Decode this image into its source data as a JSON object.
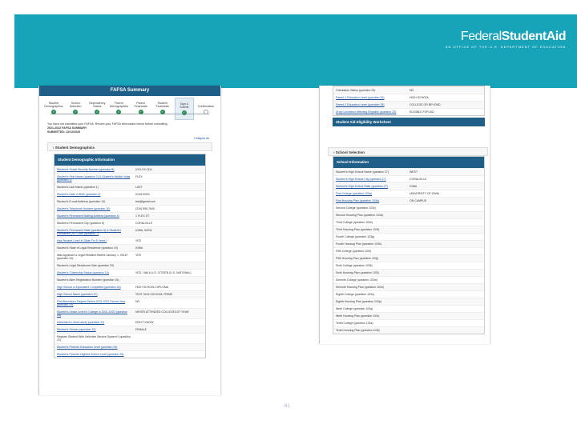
{
  "banner": {
    "brand_federal": "Federal",
    "brand_studentaid": "StudentAid",
    "tagline": "AN OFFICE OF THE U.S. DEPARTMENT OF EDUCATION"
  },
  "left_panel": {
    "title": "FAFSA Summary",
    "steps": [
      {
        "label": "Student Demographics",
        "done": true
      },
      {
        "label": "School Selection",
        "done": true
      },
      {
        "label": "Dependency Status",
        "done": true
      },
      {
        "label": "Parent Demographics",
        "done": true
      },
      {
        "label": "Parent Financials",
        "done": true
      },
      {
        "label": "Student Financials",
        "done": true
      },
      {
        "label": "Sign & Submit",
        "done": true,
        "active": true
      },
      {
        "label": "Confirmation",
        "done": false
      }
    ],
    "intro_line1": "You have not submitted your FAFSA. Review your FAFSA information below before submitting.",
    "intro_line2": "2021-2022 FAFSA SUMMARY",
    "intro_line3": "SUBMITTED: 12/12/2020",
    "collapse_all": "Collapse All",
    "section_title": "Student Demographics",
    "table_title": "Student Demographic Information",
    "rows": [
      {
        "q": "Student's Social Security Number (question 8)",
        "a": "XXX-XX-1111",
        "link": true
      },
      {
        "q": "Student's First Name (question 2) & Student's Middle Initial (question 3)",
        "a": "FLEX",
        "link": true
      },
      {
        "q": "Student's Last Name (question 1)",
        "a": "LAST",
        "link": false
      },
      {
        "q": "Student's Date of Birth (question 9)",
        "a": "01/01/2003",
        "link": true
      },
      {
        "q": "Student's E-mail Address (question 13)",
        "a": "test@gmail.com",
        "link": false
      },
      {
        "q": "Student's Telephone Number (question 10)",
        "a": "(319) 555-7840",
        "link": true
      },
      {
        "q": "Student's Permanent Mailing Address (question 4)",
        "a": "1 FLEX ST.",
        "link": true
      },
      {
        "q": "Student's Permanent City (question 5)",
        "a": "CORALVILLE",
        "link": false
      },
      {
        "q": "Student's Permanent State (question 6) & Student's Permanent ZIP Code (question 7)",
        "a": "IOWA, 52241",
        "link": true
      },
      {
        "q": "Has Student Lived In State For 5 Years?",
        "a": "YES",
        "link": true
      },
      {
        "q": "Student's State of Legal Residence (question 19)",
        "a": "IOWA",
        "link": false
      },
      {
        "q": "Was Applicant a Legal Resident Before January 1, 2016? (question 19)",
        "a": "YES",
        "link": false
      },
      {
        "q": "Student's Legal Residence Date (question 20)",
        "a": "",
        "link": false
      },
      {
        "q": "Student's Citizenship Status (question 14)",
        "a": "YES, I AM A U.S. CITIZEN (U.S. NATIONAL)",
        "link": true
      },
      {
        "q": "Student's Alien Registration Number (question 15)",
        "a": "",
        "link": false
      },
      {
        "q": "High School or Equivalent Completed (question 26)",
        "a": "HIGH SCHOOL DIPLOMA",
        "link": true
      },
      {
        "q": "High School Name (question 27)",
        "a": "TEST HIGH SCHOOL PRIME",
        "link": true
      },
      {
        "q": "First Bachelor's Degree Before 2021-2022 School Year (question 29)",
        "a": "NO",
        "link": true
      },
      {
        "q": "Student's Grade Level in College in 2021-2022 (question 28)",
        "a": "NEVER ATTENDED COLLEGE/1ST YEAR",
        "link": true
      },
      {
        "q": "Interested in Work-study (question 31)",
        "a": "DON'T KNOW",
        "link": true
      },
      {
        "q": "Student's Gender (question 21)",
        "a": "FEMALE",
        "link": true
      },
      {
        "q": "Register Student With Selective Service System? (question 22)",
        "a": "",
        "link": false
      },
      {
        "q": "Student's Parent's Education Level (question 24)",
        "a": "",
        "link": true
      },
      {
        "q": "Student's Parent's Highest School Level (question 25)",
        "a": "",
        "link": true
      }
    ]
  },
  "right_panel": {
    "top_rows": [
      {
        "q": "Orientation Status (question 23)",
        "a": "NO",
        "link": false
      },
      {
        "q": "Parent 1 Education Level (question 24)",
        "a": "HIGH SCHOOL",
        "link": true
      },
      {
        "q": "Parent 2 Education Level (question 25)",
        "a": "COLLEGE OR BEYOND",
        "link": true
      },
      {
        "q": "Drug Conviction Affecting Eligibility (question 23)",
        "a": "ELIGIBLE FOR AID",
        "link": true
      }
    ],
    "eligibility_title": "Student Aid Eligibility Worksheet",
    "section_title": "School Selection",
    "table_title": "School Information",
    "rows": [
      {
        "q": "Student's High School Name (question 27)",
        "a": "WEST",
        "link": false
      },
      {
        "q": "Student's High School City (question 27)",
        "a": "CORALVILLE",
        "link": true
      },
      {
        "q": "Student's High School State (question 27)",
        "a": "IOWA",
        "link": true
      },
      {
        "q": "First College (question 103a)",
        "a": "UNIVERSITY OF IOWA",
        "link": true
      },
      {
        "q": "First Housing Plan (question 103b)",
        "a": "ON CAMPUS",
        "link": true
      },
      {
        "q": "Second College (question 103c)",
        "a": "",
        "link": false
      },
      {
        "q": "Second Housing Plan (question 103d)",
        "a": "",
        "link": false
      },
      {
        "q": "Third College (question 103e)",
        "a": "",
        "link": false
      },
      {
        "q": "Third Housing Plan (question 103f)",
        "a": "",
        "link": false
      },
      {
        "q": "Fourth College (question 103g)",
        "a": "",
        "link": false
      },
      {
        "q": "Fourth Housing Plan (question 103h)",
        "a": "",
        "link": false
      },
      {
        "q": "Fifth College (question 103i)",
        "a": "",
        "link": false
      },
      {
        "q": "Fifth Housing Plan (question 103j)",
        "a": "",
        "link": false
      },
      {
        "q": "Sixth College (question 103k)",
        "a": "",
        "link": false
      },
      {
        "q": "Sixth Housing Plan (question 103l)",
        "a": "",
        "link": false
      },
      {
        "q": "Seventh College (question 103m)",
        "a": "",
        "link": false
      },
      {
        "q": "Seventh Housing Plan (question 103n)",
        "a": "",
        "link": false
      },
      {
        "q": "Eighth College (question 103o)",
        "a": "",
        "link": false
      },
      {
        "q": "Eighth Housing Plan (question 103p)",
        "a": "",
        "link": false
      },
      {
        "q": "Ninth College (question 103q)",
        "a": "",
        "link": false
      },
      {
        "q": "Ninth Housing Plan (question 103r)",
        "a": "",
        "link": false
      },
      {
        "q": "Tenth College (question 103s)",
        "a": "",
        "link": false
      },
      {
        "q": "Tenth Housing Plan (question 103t)",
        "a": "",
        "link": false
      }
    ]
  },
  "page_number": "61"
}
